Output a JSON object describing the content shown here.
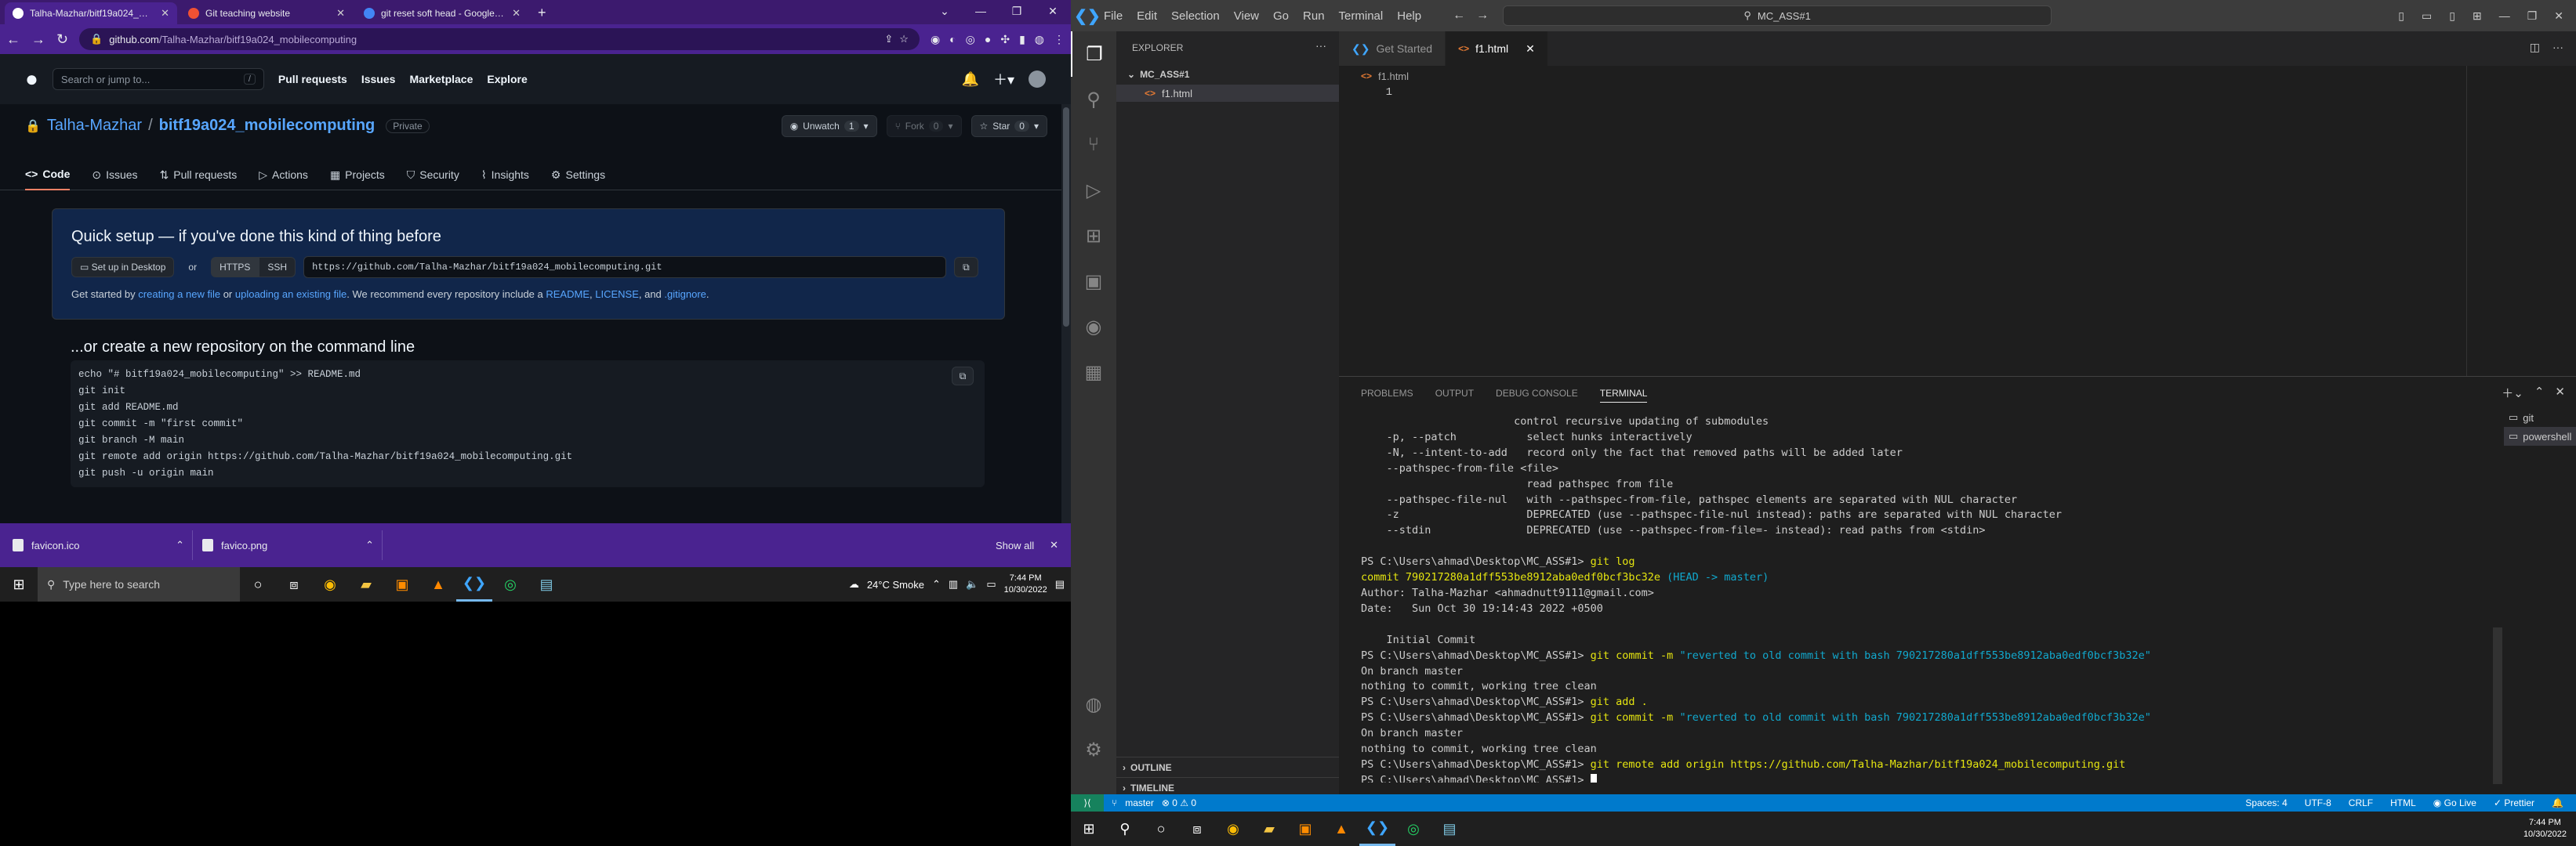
{
  "browser": {
    "tabs": [
      {
        "title": "Talha-Mazhar/bitf19a024_mobile",
        "active": true
      },
      {
        "title": "Git teaching website",
        "active": false
      },
      {
        "title": "git reset soft head - Google Sea",
        "active": false
      }
    ],
    "url_host": "github.com",
    "url_path": "/Talha-Mazhar/bitf19a024_mobilecomputing"
  },
  "github": {
    "search_placeholder": "Search or jump to...",
    "search_hint": "/",
    "nav": [
      "Pull requests",
      "Issues",
      "Marketplace",
      "Explore"
    ],
    "owner": "Talha-Mazhar",
    "repo": "bitf19a024_mobilecomputing",
    "visibility": "Private",
    "unwatch_label": "Unwatch",
    "unwatch_count": "1",
    "fork_label": "Fork",
    "fork_count": "0",
    "star_label": "Star",
    "star_count": "0",
    "tabs": [
      "Code",
      "Issues",
      "Pull requests",
      "Actions",
      "Projects",
      "Security",
      "Insights",
      "Settings"
    ],
    "setup_title": "Quick setup — if you've done this kind of thing before",
    "setup_desktop": "Set up in Desktop",
    "setup_or": "or",
    "https": "HTTPS",
    "ssh": "SSH",
    "clone_url": "https://github.com/Talha-Mazhar/bitf19a024_mobilecomputing.git",
    "desc_prefix": "Get started by",
    "desc_link1": "creating a new file",
    "desc_or": "or",
    "desc_link2": "uploading an existing file",
    "desc_mid": ". We recommend every repository include a",
    "desc_readme": "README",
    "desc_license": "LICENSE",
    "desc_and": ", and",
    "desc_gitignore": ".gitignore",
    "cmd_title": "...or create a new repository on the command line",
    "cmd_lines": "echo \"# bitf19a024_mobilecomputing\" >> README.md\ngit init\ngit add README.md\ngit commit -m \"first commit\"\ngit branch -M main\ngit remote add origin https://github.com/Talha-Mazhar/bitf19a024_mobilecomputing.git\ngit push -u origin main"
  },
  "downloads": {
    "items": [
      "favicon.ico",
      "favico.png"
    ],
    "show_all": "Show all"
  },
  "taskbar_left": {
    "search_placeholder": "Type here to search",
    "weather": "24°C  Smoke",
    "time": "7:44 PM",
    "date": "10/30/2022"
  },
  "vscode": {
    "menu": [
      "File",
      "Edit",
      "Selection",
      "View",
      "Go",
      "Run",
      "Terminal",
      "Help"
    ],
    "command_center": "MC_ASS#1",
    "explorer_title": "EXPLORER",
    "folder": "MC_ASS#1",
    "file": "f1.html",
    "tabs": [
      "Get Started",
      "f1.html"
    ],
    "breadcrumb": "f1.html",
    "line_number": "1",
    "outline": "OUTLINE",
    "timeline": "TIMELINE",
    "panel_tabs": [
      "PROBLEMS",
      "OUTPUT",
      "DEBUG CONSOLE",
      "TERMINAL"
    ],
    "terminals": [
      "git",
      "powershell"
    ],
    "status": {
      "branch": "master",
      "spaces": "Spaces: 4",
      "encoding": "UTF-8",
      "eol": "CRLF",
      "language": "HTML",
      "golive": "Go Live",
      "prettier": "Prettier"
    }
  },
  "terminal": {
    "lines": [
      "                        control recursive updating of submodules",
      "    -p, --patch           select hunks interactively",
      "    -N, --intent-to-add   record only the fact that removed paths will be added later",
      "    --pathspec-from-file <file>",
      "                          read pathspec from file",
      "    --pathspec-file-nul   with --pathspec-from-file, pathspec elements are separated with NUL character",
      "    -z                    DEPRECATED (use --pathspec-file-nul instead): paths are separated with NUL character",
      "    --stdin               DEPRECATED (use --pathspec-from-file=- instead): read paths from <stdin>",
      ""
    ],
    "prompt": "PS C:\\Users\\ahmad\\Desktop\\MC_ASS#1>",
    "log_cmd": "git log",
    "commit_line": "commit 790217280a1dff553be8912aba0edf0bcf3bc32e",
    "head_ref": "(HEAD -> master)",
    "author": "Author: Talha-Mazhar <ahmadnutt9111@gmail.com>",
    "date": "Date:   Sun Oct 30 19:14:43 2022 +0500",
    "message": "    Initial Commit",
    "commit_cmd": "git commit -m",
    "commit_msg": "\"reverted to old commit with bash 790217280a1dff553be8912aba0edf0bcf3b32e\"",
    "on_branch": "On branch master",
    "clean": "nothing to commit, working tree clean",
    "add_cmd": "git add .",
    "remote_cmd": "git remote add origin https://github.com/Talha-Mazhar/bitf19a024_mobilecomputing.git"
  },
  "taskbar_right": {
    "time": "7:44 PM",
    "date": "10/30/2022"
  },
  "colors": {
    "browser_frame": "#4a2390",
    "github_bg": "#0d1117",
    "vscode_statusbar": "#007acc"
  }
}
